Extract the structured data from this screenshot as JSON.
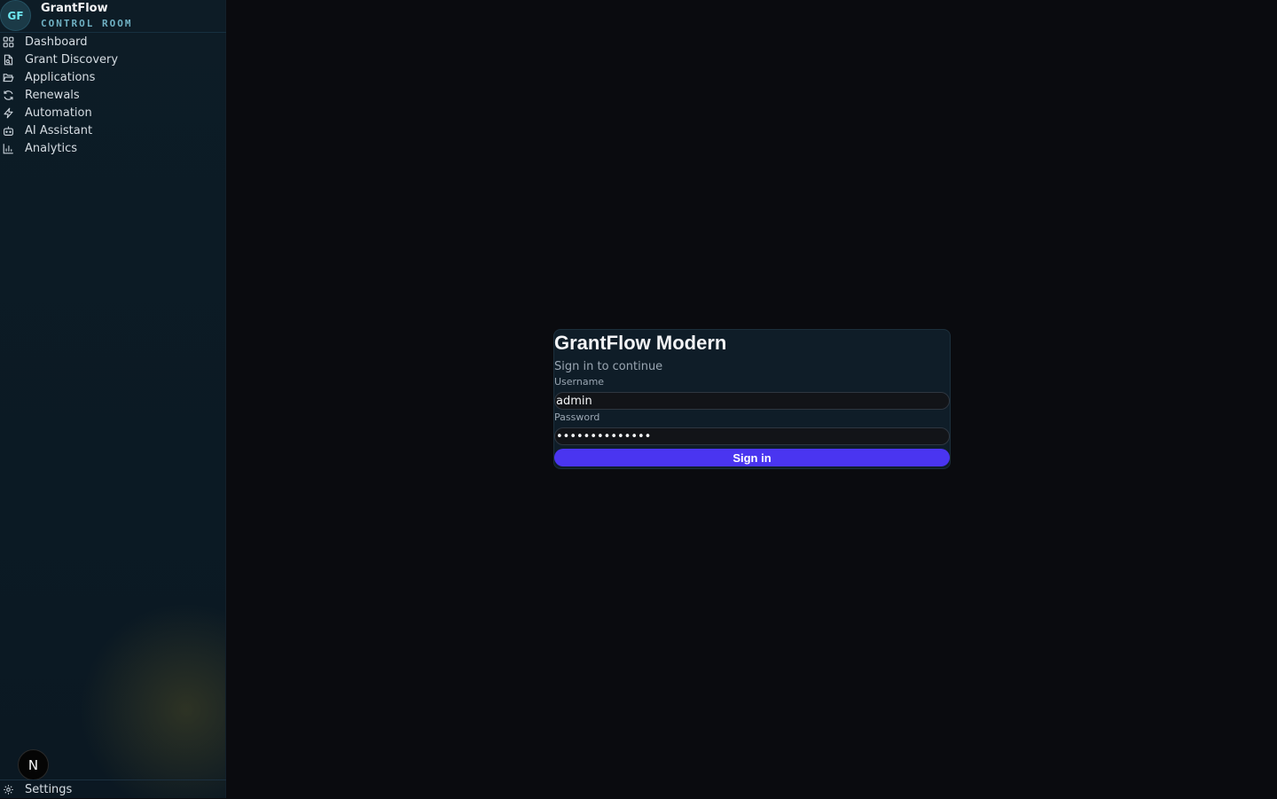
{
  "brand": {
    "badge": "GF",
    "title": "GrantFlow",
    "subtitle": "CONTROL ROOM"
  },
  "sidebar": {
    "items": [
      {
        "label": "Dashboard",
        "icon": "grid-icon"
      },
      {
        "label": "Grant Discovery",
        "icon": "document-search-icon"
      },
      {
        "label": "Applications",
        "icon": "folder-open-icon"
      },
      {
        "label": "Renewals",
        "icon": "refresh-icon"
      },
      {
        "label": "Automation",
        "icon": "lightning-icon"
      },
      {
        "label": "AI Assistant",
        "icon": "bot-icon"
      },
      {
        "label": "Analytics",
        "icon": "bar-chart-icon"
      }
    ],
    "avatar_letter": "N",
    "settings_label": "Settings"
  },
  "login": {
    "title": "GrantFlow Modern",
    "subtitle": "Sign in to continue",
    "username_label": "Username",
    "username_value": "admin",
    "password_label": "Password",
    "password_value": "••••••••••••••",
    "submit_label": "Sign in"
  },
  "colors": {
    "accent": "#4a35f0",
    "background": "#0a0b0f",
    "sidebar": "#0c1b25",
    "badge_text": "#6ee7f0"
  }
}
